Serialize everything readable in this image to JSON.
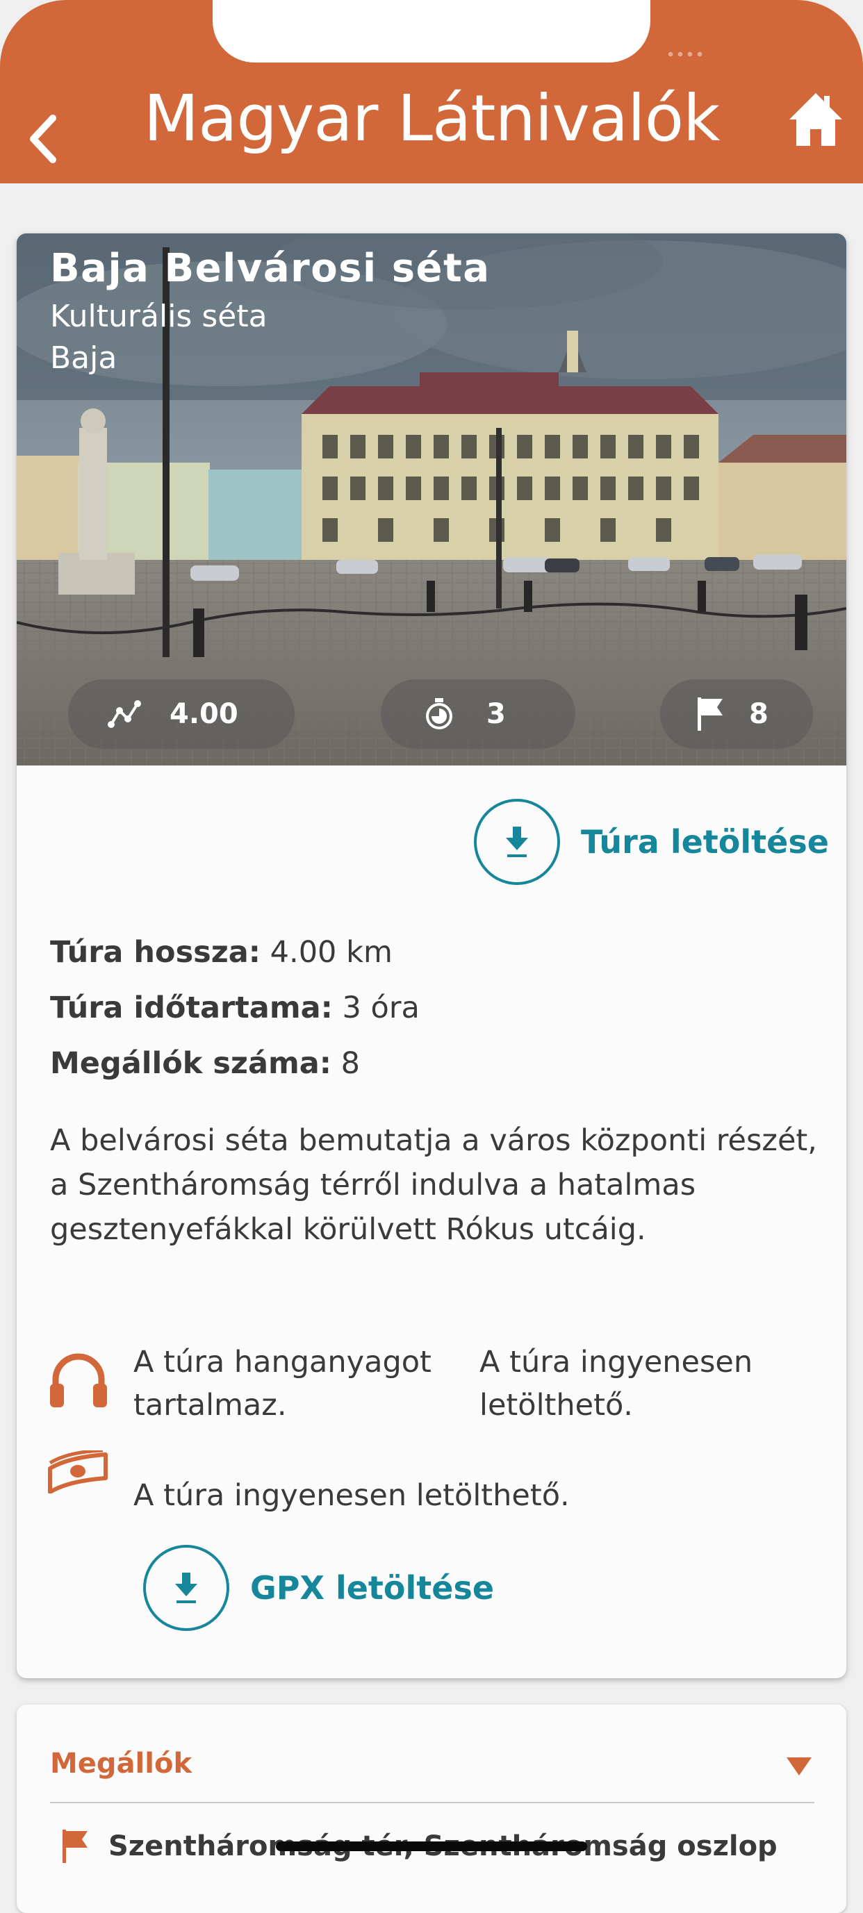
{
  "header": {
    "title": "Magyar Látnivalók",
    "back_icon": "chevron-left-icon",
    "home_icon": "home-icon",
    "color": "#d2683a"
  },
  "tour": {
    "title": "Baja Belvárosi séta",
    "category": "Kulturális séta",
    "city": "Baja",
    "stats": {
      "distance": "4.00",
      "duration": "3",
      "stops": "8"
    },
    "download_label": "Túra letöltése",
    "details": [
      {
        "label": "Túra hossza:",
        "value": "4.00 km"
      },
      {
        "label": "Túra időtartama:",
        "value": "3 óra"
      },
      {
        "label": "Megállók száma:",
        "value": "8"
      }
    ],
    "description": "A belvárosi séta bemutatja a város központi részét, a Szentháromság térről indulva a hatalmas gesztenyefákkal körülvett Rókus utcáig.",
    "features": {
      "audio": "A túra hanganyagot tartalmaz.",
      "audio_side": "A túra ingyenesen letölthető.",
      "free": "A túra ingyenesen letölthető."
    },
    "gpx_label": "GPX letöltése"
  },
  "stops": {
    "title": "Megállók",
    "items": [
      {
        "name": "Szentháromság tér, Szentháromság oszlop"
      }
    ]
  },
  "colors": {
    "accent": "#d2683a",
    "teal": "#16869a",
    "text": "#3a3a3a"
  }
}
